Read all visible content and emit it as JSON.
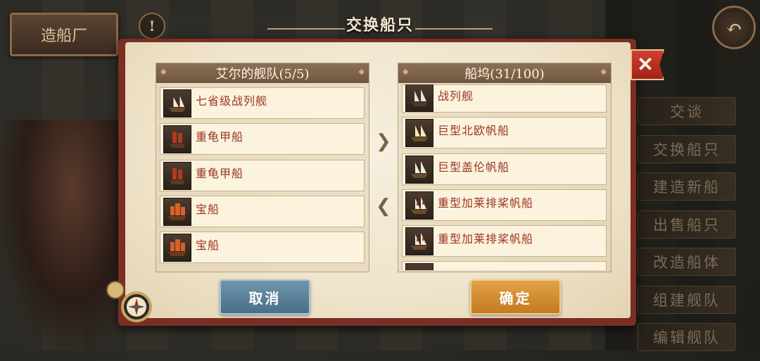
{
  "background": {
    "sign_label": "造船厂",
    "alert_glyph": "!",
    "back_glyph": "↶",
    "side_menu": [
      "交谈",
      "交换船只",
      "建造新船",
      "出售船只",
      "改造船体",
      "组建舰队",
      "编辑舰队"
    ]
  },
  "dialog": {
    "title": "交换船只",
    "close_glyph": "✕",
    "left_panel": {
      "header": "艾尔的舰队(5/5)",
      "ships": [
        {
          "name": "七省级战列舰",
          "icon": "galleon-icon"
        },
        {
          "name": "重龟甲船",
          "icon": "turtle-ship-icon"
        },
        {
          "name": "重龟甲船",
          "icon": "turtle-ship-icon"
        },
        {
          "name": "宝船",
          "icon": "treasure-ship-icon"
        },
        {
          "name": "宝船",
          "icon": "treasure-ship-icon"
        }
      ]
    },
    "right_panel": {
      "header": "船坞(31/100)",
      "ships": [
        {
          "name": "战列舰",
          "icon": "ship-of-the-line-icon"
        },
        {
          "name": "巨型北欧帆船",
          "icon": "nordic-sailship-icon"
        },
        {
          "name": "巨型盖伦帆船",
          "icon": "galleon-icon"
        },
        {
          "name": "重型加莱排桨帆船",
          "icon": "galleass-icon"
        },
        {
          "name": "重型加莱排桨帆船",
          "icon": "galleass-icon"
        },
        {
          "name": "",
          "icon": "ship-icon"
        }
      ]
    },
    "arrow_right": "❯",
    "arrow_left": "❮",
    "cancel_label": "取消",
    "confirm_label": "确定"
  },
  "colors": {
    "frame": "#7a2e24",
    "ship_name": "#9b3422",
    "cancel": "#5a82a0",
    "confirm": "#d48f33"
  }
}
